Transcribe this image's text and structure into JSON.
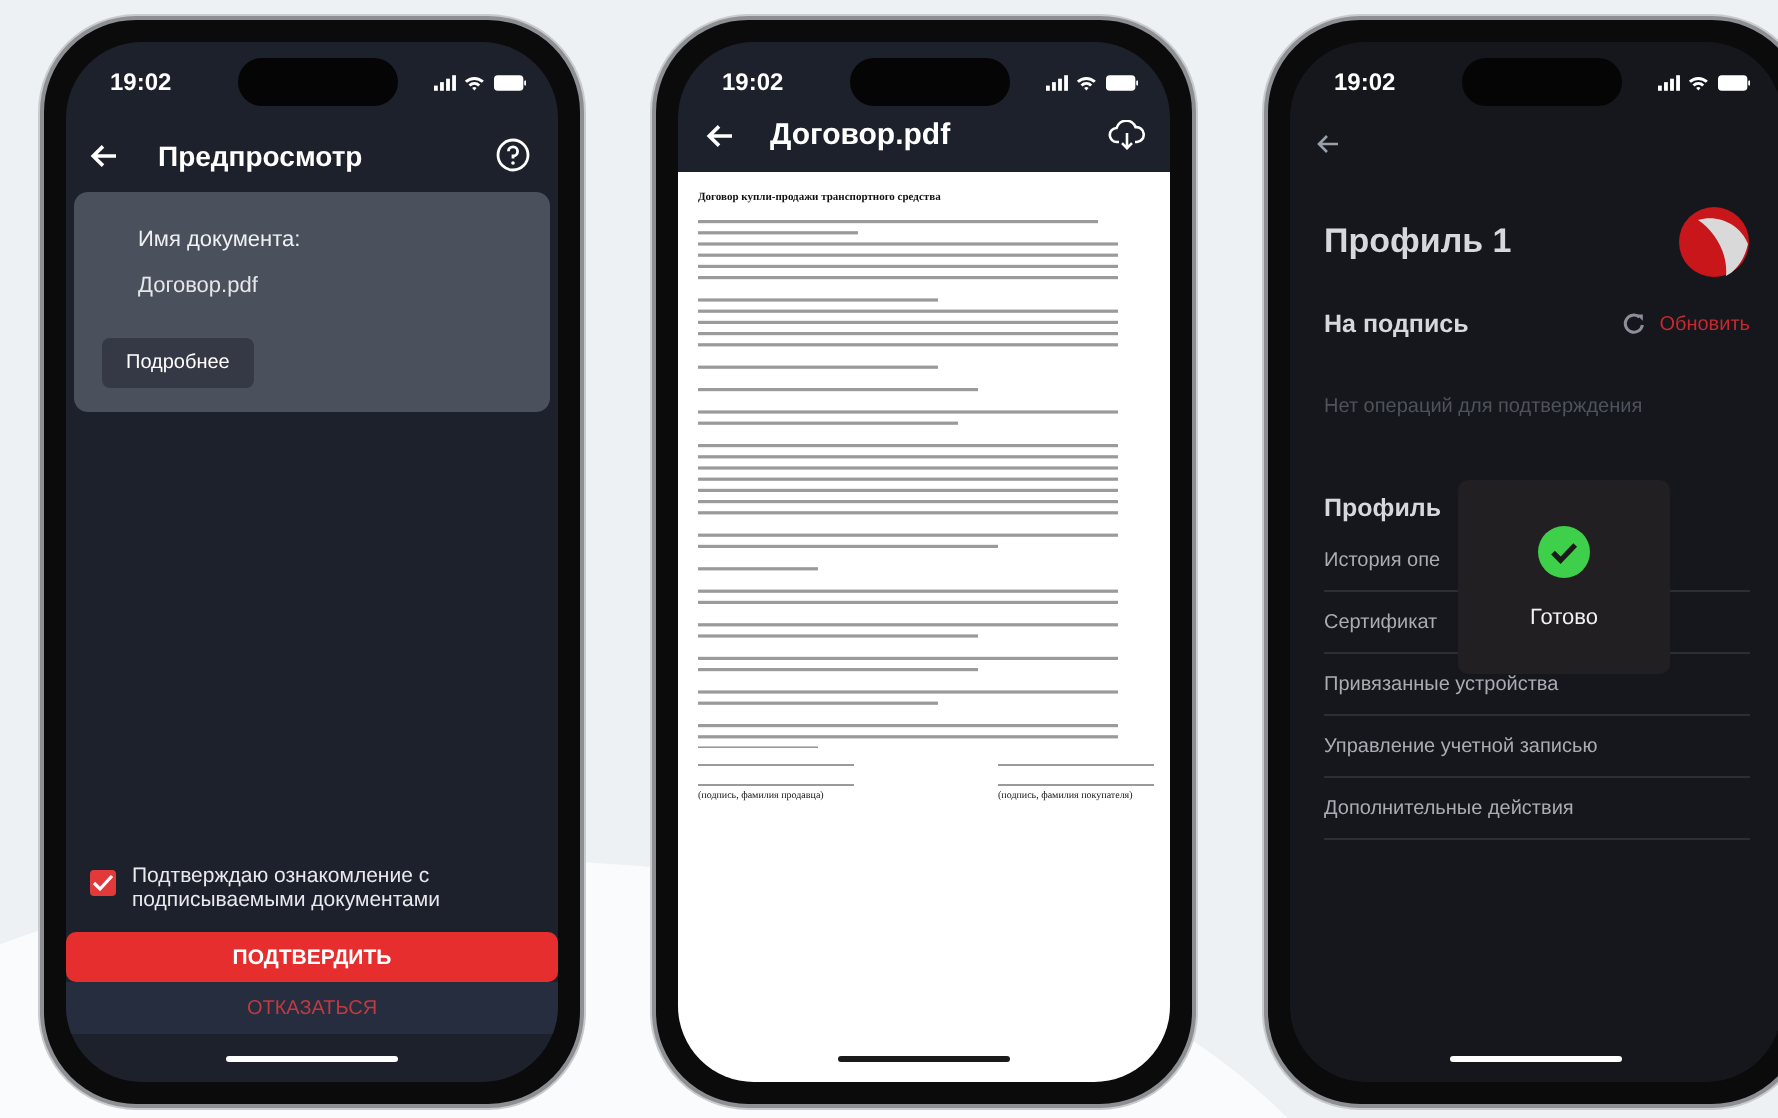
{
  "preview_screen": {
    "status_time": "19:02",
    "title": "Предпросмотр",
    "document_card": {
      "label": "Имя документа:",
      "filename": "Договор.pdf",
      "details_button": "Подробнее"
    },
    "consent": {
      "text": "Подтверждаю ознакомление с подписываемыми документами",
      "checked": true
    },
    "confirm_button": "ПОДТВЕРДИТЬ",
    "decline_button": "ОТКАЗАТЬСЯ"
  },
  "document_screen": {
    "status_time": "19:02",
    "title": "Договор.pdf",
    "document": {
      "heading": "Договор купли-продажи транспортного средства",
      "signature_captions": [
        "(подпись, фамилия продавца)",
        "(подпись, фамилия покупателя)"
      ]
    }
  },
  "profile_screen": {
    "status_time": "19:02",
    "title": "Профиль 1",
    "pending": {
      "heading": "На подпись",
      "refresh_label": "Обновить",
      "empty_text": "Нет операций для подтверждения"
    },
    "section_title": "Профиль",
    "menu_items": [
      "История опе",
      "Сертификат",
      "Привязанные устройства",
      "Управление учетной записью",
      "Дополнительные действия"
    ],
    "toast": {
      "text": "Готово"
    }
  }
}
